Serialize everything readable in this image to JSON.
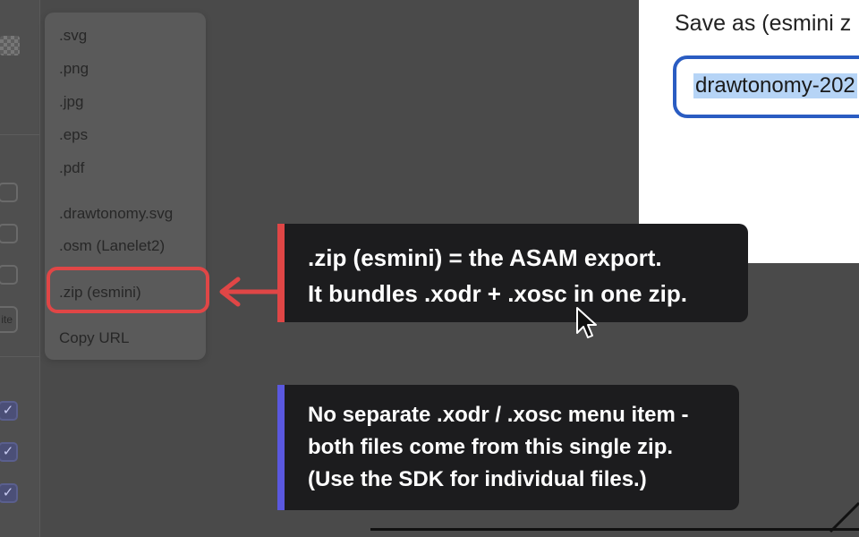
{
  "export_menu": {
    "items": [
      {
        "label": ".svg"
      },
      {
        "label": ".png"
      },
      {
        "label": ".jpg"
      },
      {
        "label": ".eps"
      },
      {
        "label": ".pdf"
      },
      {
        "label": ".drawtonomy.svg"
      },
      {
        "label": ".osm (Lanelet2)"
      },
      {
        "label": ".zip (esmini)",
        "highlighted": true
      },
      {
        "label": "Copy URL"
      }
    ]
  },
  "save_dialog": {
    "title": "Save as (esmini z",
    "filename_value": "drawtonomy-202"
  },
  "sidebar": {
    "partial_button_label": "ite",
    "checkbox_states": [
      false,
      false,
      false,
      true,
      true,
      true
    ]
  },
  "callouts": [
    {
      "accent": "#e04646",
      "lines": [
        ".zip (esmini) = the ASAM export.",
        "It bundles .xodr + .xosc in one zip."
      ]
    },
    {
      "accent": "#5a58e0",
      "lines": [
        "No separate .xodr / .xosc menu item -",
        "both files come from this single zip.",
        "(Use the SDK for individual files.)"
      ]
    }
  ],
  "colors": {
    "highlight_red": "#e04646",
    "note_purple": "#5a58e0",
    "selection_blue": "#2a5cc2"
  },
  "icons": [
    "arrow-left-icon",
    "mouse-pointer-icon",
    "checkmark-icon",
    "checkerboard-icon"
  ]
}
